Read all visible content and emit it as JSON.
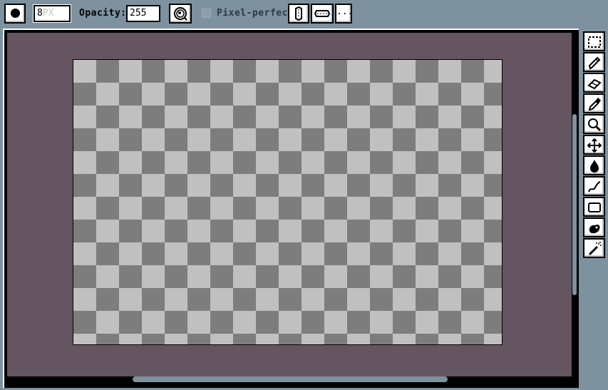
{
  "context_bar": {
    "brush_size": "8",
    "brush_unit": "PX",
    "opacity_label": "Opacity:",
    "opacity_value": "255",
    "pixel_perfect_label": "Pixel-perfect",
    "pixel_perfect_checked": false,
    "more_label": "...",
    "icons": [
      "brush-type-icon",
      "dynamics-icon",
      "symmetry-vertical-icon",
      "symmetry-horizontal-icon"
    ]
  },
  "canvas": {
    "background_color": "#655560",
    "checker_light": "#c0c0c0",
    "checker_dark": "#7d7d7d"
  },
  "toolbar": {
    "tools": [
      {
        "name": "rectangular-marquee-tool",
        "icon": "marquee-icon"
      },
      {
        "name": "pencil-tool",
        "icon": "pencil-icon"
      },
      {
        "name": "eraser-tool",
        "icon": "eraser-icon"
      },
      {
        "name": "eyedropper-tool",
        "icon": "eyedropper-icon"
      },
      {
        "name": "zoom-tool",
        "icon": "magnifier-icon"
      },
      {
        "name": "move-tool",
        "icon": "move-icon"
      },
      {
        "name": "paint-bucket-tool",
        "icon": "bucket-icon"
      },
      {
        "name": "curve-tool",
        "icon": "curve-icon"
      },
      {
        "name": "rectangle-tool",
        "icon": "rectangle-icon"
      },
      {
        "name": "contour-tool",
        "icon": "contour-icon"
      },
      {
        "name": "blur-tool",
        "icon": "blur-icon"
      }
    ]
  },
  "colors": {
    "ui_background": "#7d929e",
    "button_face": "#ffffff",
    "outline": "#000000"
  }
}
